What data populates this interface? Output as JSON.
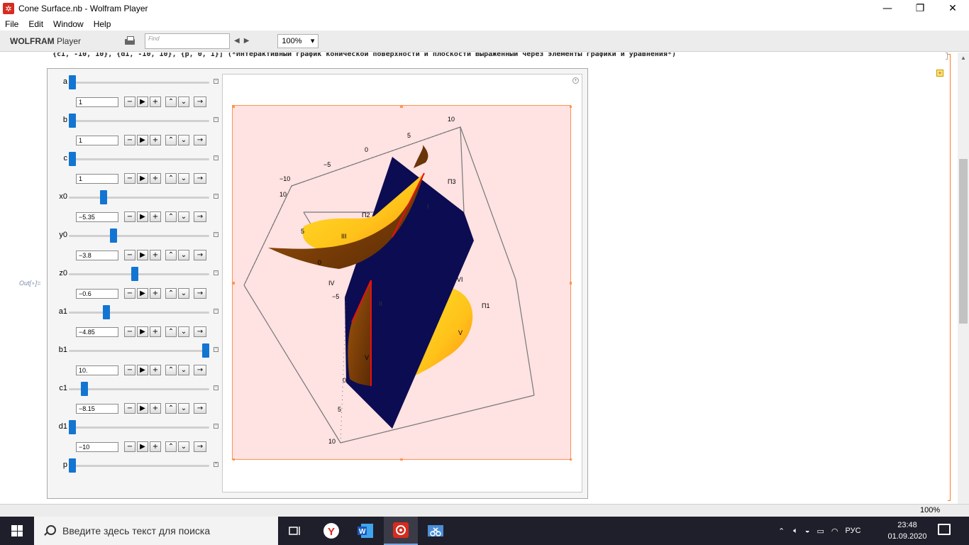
{
  "window": {
    "title": "Cone Surface.nb - Wolfram Player",
    "app_icon_glyph": "✲",
    "minimize": "—",
    "maximize": "❐",
    "close": "✕"
  },
  "menu": [
    "File",
    "Edit",
    "Window",
    "Help"
  ],
  "toolbar": {
    "brand_bold": "WOLFRAM",
    "brand_rest": " Player",
    "find_placeholder": "Find",
    "zoom": "100%"
  },
  "notebook": {
    "code_line": "{c1, -10, 10}, {d1, -10, 10}, {p, 0, 1}] (*Интерактивный график конической поверхности и плоскости выраженный через элементы графики и уравнения*)",
    "out_label": "Out[∘]="
  },
  "controls": [
    {
      "label": "a",
      "value": "1",
      "fraction": 0.0
    },
    {
      "label": "b",
      "value": "1",
      "fraction": 0.0
    },
    {
      "label": "c",
      "value": "1",
      "fraction": 0.0
    },
    {
      "label": "x0",
      "value": "−5.35",
      "fraction": 0.2325
    },
    {
      "label": "y0",
      "value": "−3.8",
      "fraction": 0.31
    },
    {
      "label": "z0",
      "value": "−0.6",
      "fraction": 0.47
    },
    {
      "label": "a1",
      "value": "−4.85",
      "fraction": 0.2575
    },
    {
      "label": "b1",
      "value": "10.",
      "fraction": 1.0
    },
    {
      "label": "c1",
      "value": "−8.15",
      "fraction": 0.0925
    },
    {
      "label": "d1",
      "value": "−10",
      "fraction": 0.0
    },
    {
      "label": "p",
      "value": "",
      "fraction": 0.0
    }
  ],
  "buttons": {
    "minus": "−",
    "play": "▶",
    "plus": "+",
    "faster": "⌃",
    "slower": "⌄",
    "direction": "→"
  },
  "plot": {
    "axis_labels": [
      "10",
      "5",
      "0",
      "−5",
      "−10",
      "10",
      "5",
      "0",
      "−5",
      "0",
      "5",
      "10"
    ],
    "region_labels": [
      "П2",
      "П3",
      "III",
      "IV",
      "VI",
      "П1",
      "V",
      "V",
      "II",
      "I"
    ]
  },
  "statusbar": {
    "zoom": "100%"
  },
  "taskbar": {
    "search_placeholder": "Введите здесь текст для поиска",
    "language": "РУС",
    "time": "23:48",
    "date": "01.09.2020"
  }
}
